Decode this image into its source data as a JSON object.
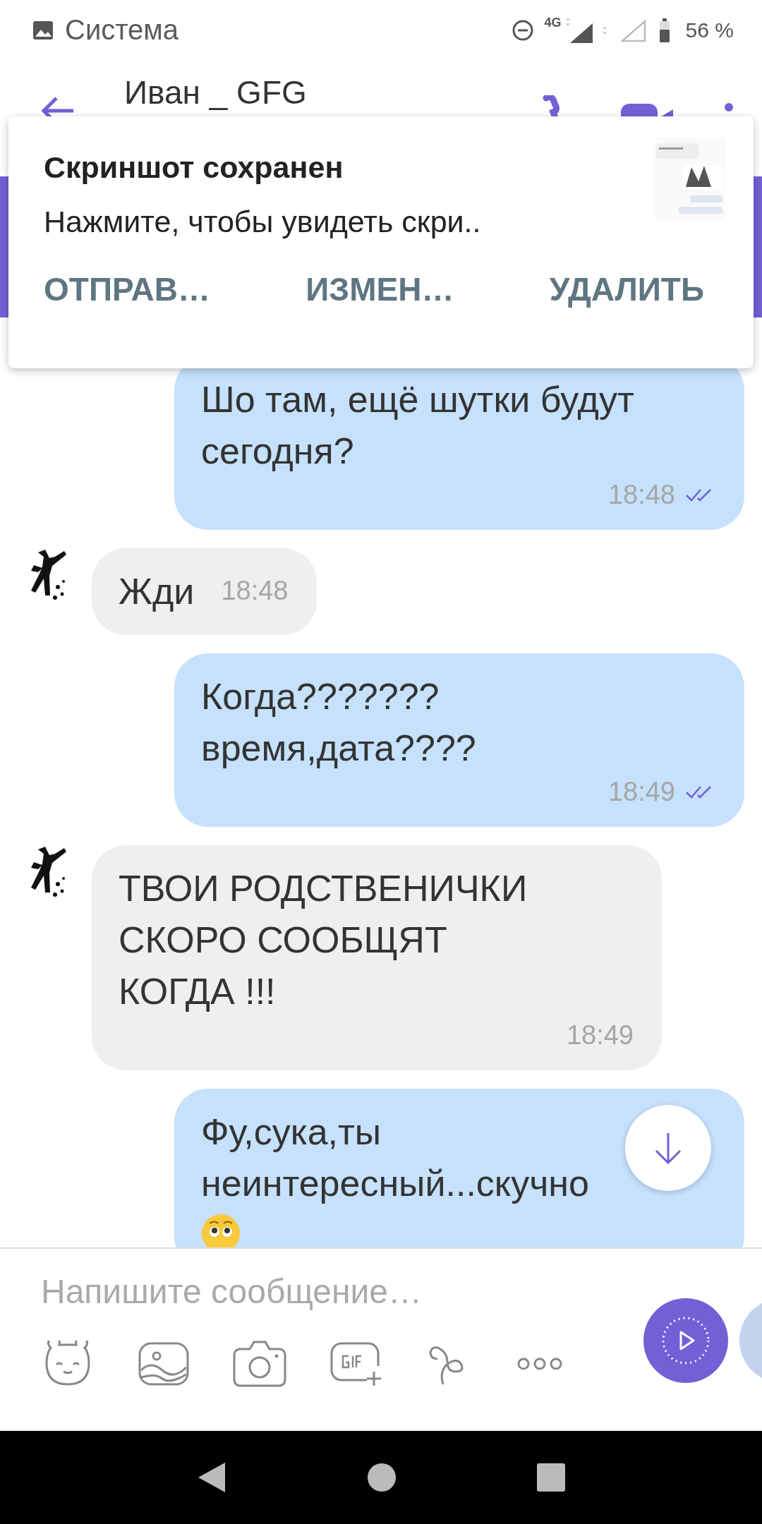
{
  "status_bar": {
    "app": "Система",
    "network": "4G",
    "battery": "56 %"
  },
  "header": {
    "title": "Иван _ GFG"
  },
  "notification": {
    "title": "Скриншот сохранен",
    "text": "Нажмите, чтобы увидеть скри..",
    "actions": [
      "ОТПРАВ…",
      "ИЗМЕН…",
      "УДАЛИТЬ"
    ]
  },
  "messages": [
    {
      "kind": "out",
      "text": "Шо там, ещё шутки будут сегодня?",
      "time": "18:48",
      "read": true
    },
    {
      "kind": "in",
      "text": "Жди",
      "time": "18:48"
    },
    {
      "kind": "out",
      "text": "Когда???????\nвремя,дата????",
      "time": "18:49",
      "read": true
    },
    {
      "kind": "in",
      "text": "ТВОИ РОДСТВЕНИЧКИ\nСКОРО СООБЩЯТ\nКОГДА !!!",
      "time": "18:49"
    },
    {
      "kind": "out",
      "text": "Фу,сука,ты неинтересный...скучно",
      "trailing_emoji": true
    }
  ],
  "composer": {
    "placeholder": "Напишите сообщение…"
  }
}
